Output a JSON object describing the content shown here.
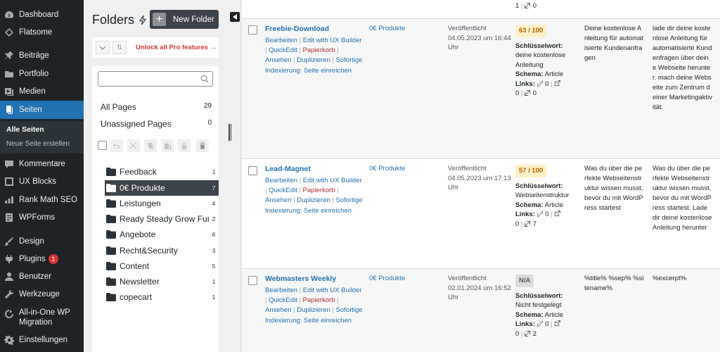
{
  "admin_menu": {
    "items": [
      {
        "label": "Dashboard",
        "icon": "dashboard-icon"
      },
      {
        "label": "Flatsome",
        "icon": "flatsome-icon"
      },
      {
        "label": "Beiträge",
        "icon": "pin-icon"
      },
      {
        "label": "Portfolio",
        "icon": "portfolio-icon"
      },
      {
        "label": "Medien",
        "icon": "media-icon"
      },
      {
        "label": "Seiten",
        "icon": "pages-icon"
      },
      {
        "label": "Kommentare",
        "icon": "comments-icon"
      },
      {
        "label": "UX Blocks",
        "icon": "ux-blocks-icon"
      },
      {
        "label": "Rank Math SEO",
        "icon": "rank-math-icon"
      },
      {
        "label": "WPForms",
        "icon": "wpforms-icon"
      },
      {
        "label": "Design",
        "icon": "brush-icon"
      },
      {
        "label": "Plugins",
        "icon": "plugins-icon",
        "badge": "1"
      },
      {
        "label": "Benutzer",
        "icon": "users-icon"
      },
      {
        "label": "Werkzeuge",
        "icon": "tools-icon"
      },
      {
        "label": "All-in-One WP Migration",
        "icon": "migration-icon"
      },
      {
        "label": "Einstellungen",
        "icon": "settings-icon"
      }
    ],
    "submenu": [
      {
        "label": "Alle Seiten"
      },
      {
        "label": "Neue Seite erstellen"
      }
    ]
  },
  "folders": {
    "title": "Folders",
    "new_folder_label": "New Folder",
    "unlock_pro": "Unlock all Pro features →",
    "search_placeholder": "",
    "all_pages": {
      "label": "All Pages",
      "count": "29"
    },
    "unassigned": {
      "label": "Unassigned Pages",
      "count": "0"
    },
    "list": [
      {
        "name": "Feedback",
        "count": "1"
      },
      {
        "name": "0€ Produkte",
        "count": "7"
      },
      {
        "name": "Leistungen",
        "count": "4"
      },
      {
        "name": "Ready Steady Grow Fun",
        "count": "2"
      },
      {
        "name": "Angebote",
        "count": "6"
      },
      {
        "name": "Recht&Security",
        "count": "3"
      },
      {
        "name": "Content",
        "count": "5"
      },
      {
        "name": "Newsletter",
        "count": "1"
      },
      {
        "name": "copecart",
        "count": "1"
      }
    ]
  },
  "table": {
    "top_fragment": {
      "a": "1",
      "b": "0"
    },
    "rows": [
      {
        "title": "Freebie-Download",
        "actions": {
          "edit": "Bearbeiten",
          "ux": "Edit with UX Builder",
          "quick": "QuickEdit",
          "trash": "Papierkorb",
          "view": "Ansehen",
          "dup": "Duplizieren",
          "index": "Sofortige Indexierung: Seite einreichen"
        },
        "folder": "0€ Produkte",
        "status": "Veröffentlicht",
        "date": "04.05.2023 um 16:44 Uhr",
        "seo_score": "63 / 100",
        "keyword_label": "Schlüsselwort:",
        "keyword": "deine kostenlose Anleitung",
        "schema_label": "Schema:",
        "schema": "Article",
        "links_label": "Links:",
        "links": {
          "internal": "0",
          "external": "0",
          "incoming": "0"
        },
        "seo_title": "Deine kostenlose Anleitung für automatisierte Kundenanfragen",
        "seo_desc": "lade dir deine kostenlose Anleitung für automatisierte Kundenfragen über deine Webseite herunter. mach deine Webseite zum Zentrum deiner Marketingaktivität."
      },
      {
        "title": "Lead-Magnet",
        "actions": {
          "edit": "Bearbeiten",
          "ux": "Edit with UX Builder",
          "quick": "QuickEdit",
          "trash": "Papierkorb",
          "view": "Ansehen",
          "dup": "Duplizieren",
          "index": "Sofortige Indexierung: Seite einreichen"
        },
        "folder": "0€ Produkte",
        "status": "Veröffentlicht",
        "date": "04.05.2023 um 17:13 Uhr",
        "seo_score": "57 / 100",
        "keyword_label": "Schlüsselwort:",
        "keyword": "Webseitenstruktur",
        "schema_label": "Schema:",
        "schema": "Article",
        "links_label": "Links:",
        "links": {
          "internal": "0",
          "external": "0",
          "incoming": "7"
        },
        "seo_title": "Was du über die perfekte Webseitenstruktur wissen musst, bevor du mit WordPress startest",
        "seo_desc": "Was du über die perfekte Webseitenstruktur wissen musst, bevor du mit WordPress startest. Lade dir deine kostenlose Anleitung herunter"
      },
      {
        "title": "Webmasters Weekly",
        "actions": {
          "edit": "Bearbeiten",
          "ux": "Edit with UX Builder",
          "quick": "QuickEdit",
          "trash": "Papierkorb",
          "view": "Ansehen",
          "dup": "Duplizieren",
          "index": "Sofortige Indexierung: Seite einreichen"
        },
        "folder": "0€ Produkte",
        "status": "Veröffentlicht",
        "date": "02.01.2024 um 16:52 Uhr",
        "seo_score": "N/A",
        "keyword_label": "Schlüsselwort:",
        "keyword": "Nicht festgelegt",
        "schema_label": "Schema:",
        "schema": "Article",
        "links_label": "Links:",
        "links": {
          "internal": "0",
          "external": "0",
          "incoming": "2"
        },
        "seo_title": "%title% %sep% %sitename%",
        "seo_desc": "%excerpt%"
      }
    ]
  },
  "colors": {
    "admin_bg": "#1d2327",
    "accent": "#2271b1",
    "trash": "#b32d2e",
    "unlock": "#d63638"
  }
}
